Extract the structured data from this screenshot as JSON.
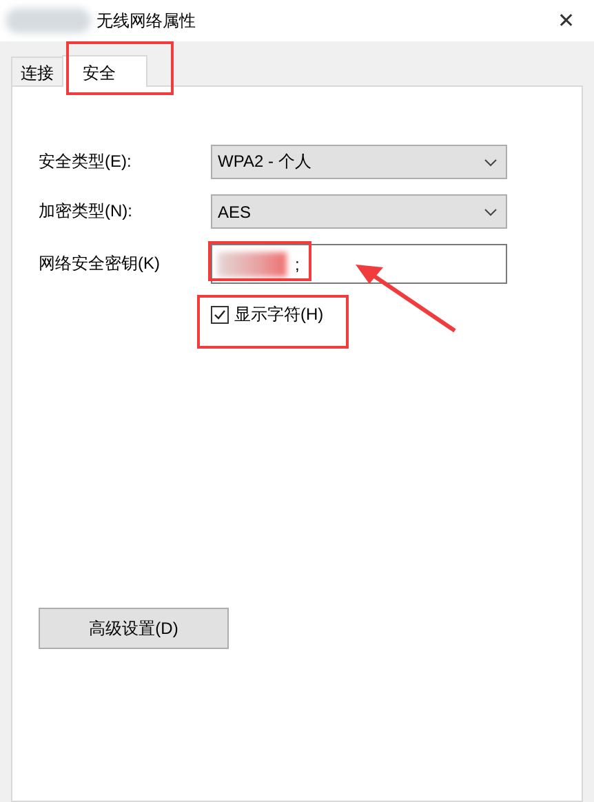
{
  "window": {
    "title": "无线网络属性",
    "close": "✕"
  },
  "tabs": [
    {
      "label": "连接",
      "selected": false
    },
    {
      "label": "安全",
      "selected": true
    }
  ],
  "fields": [
    {
      "kind": "dropdown",
      "label": "安全类型(E):",
      "value": "WPA2 - 个人"
    },
    {
      "kind": "dropdown",
      "label": "加密类型(N):",
      "value": "AES"
    },
    {
      "kind": "text",
      "label": "网络安全密钥(K)",
      "value": ";"
    }
  ],
  "show_characters": {
    "label": "显示字符(H)",
    "checked": true
  },
  "buttons": [
    {
      "label": "高级设置(D)"
    }
  ]
}
